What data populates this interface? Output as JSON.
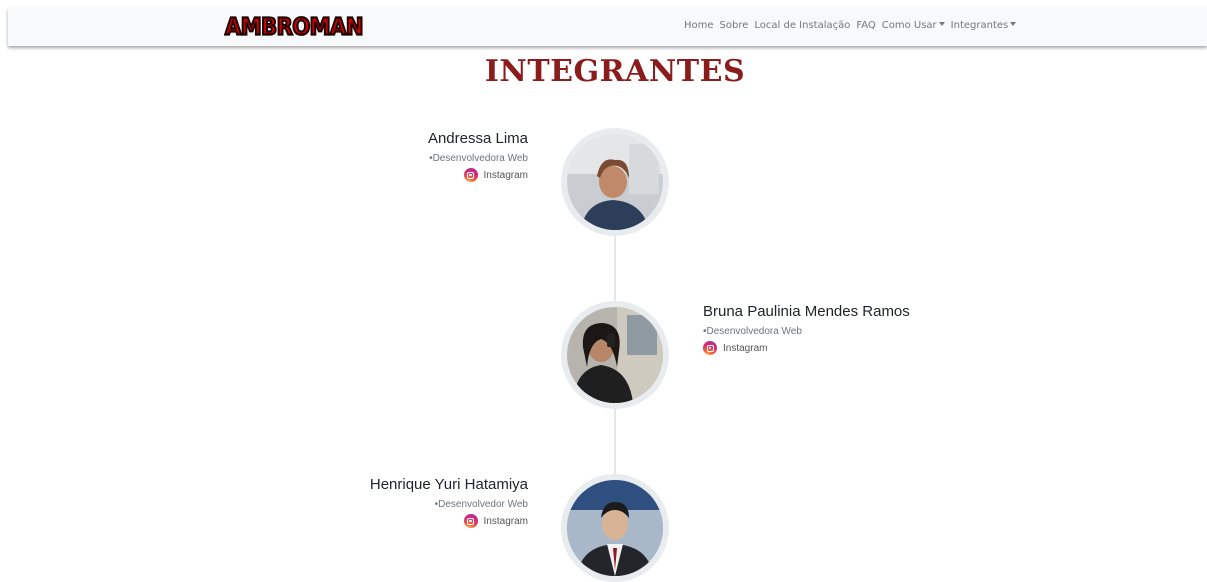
{
  "navbar": {
    "logo_text": "AMBROMAN",
    "links": {
      "home": "Home",
      "sobre": "Sobre",
      "local": "Local de Instalação",
      "faq": "FAQ",
      "como_usar": "Como Usar",
      "integrantes": "Integrantes"
    }
  },
  "page": {
    "title": "INTEGRANTES"
  },
  "members": [
    {
      "name": "Andressa Lima",
      "role": "•Desenvolvedora Web",
      "link_label": "Instagram"
    },
    {
      "name": "Bruna Paulinia Mendes Ramos",
      "role": "•Desenvolvedora Web",
      "link_label": "Instagram"
    },
    {
      "name": "Henrique Yuri Hatamiya",
      "role": "•Desenvolvedor Web",
      "link_label": "Instagram"
    }
  ],
  "colors": {
    "title": "#8b1c1c",
    "logo": "#d10000",
    "navbar_bg": "#f8f9fa",
    "avatar_border": "#e9ecef"
  }
}
